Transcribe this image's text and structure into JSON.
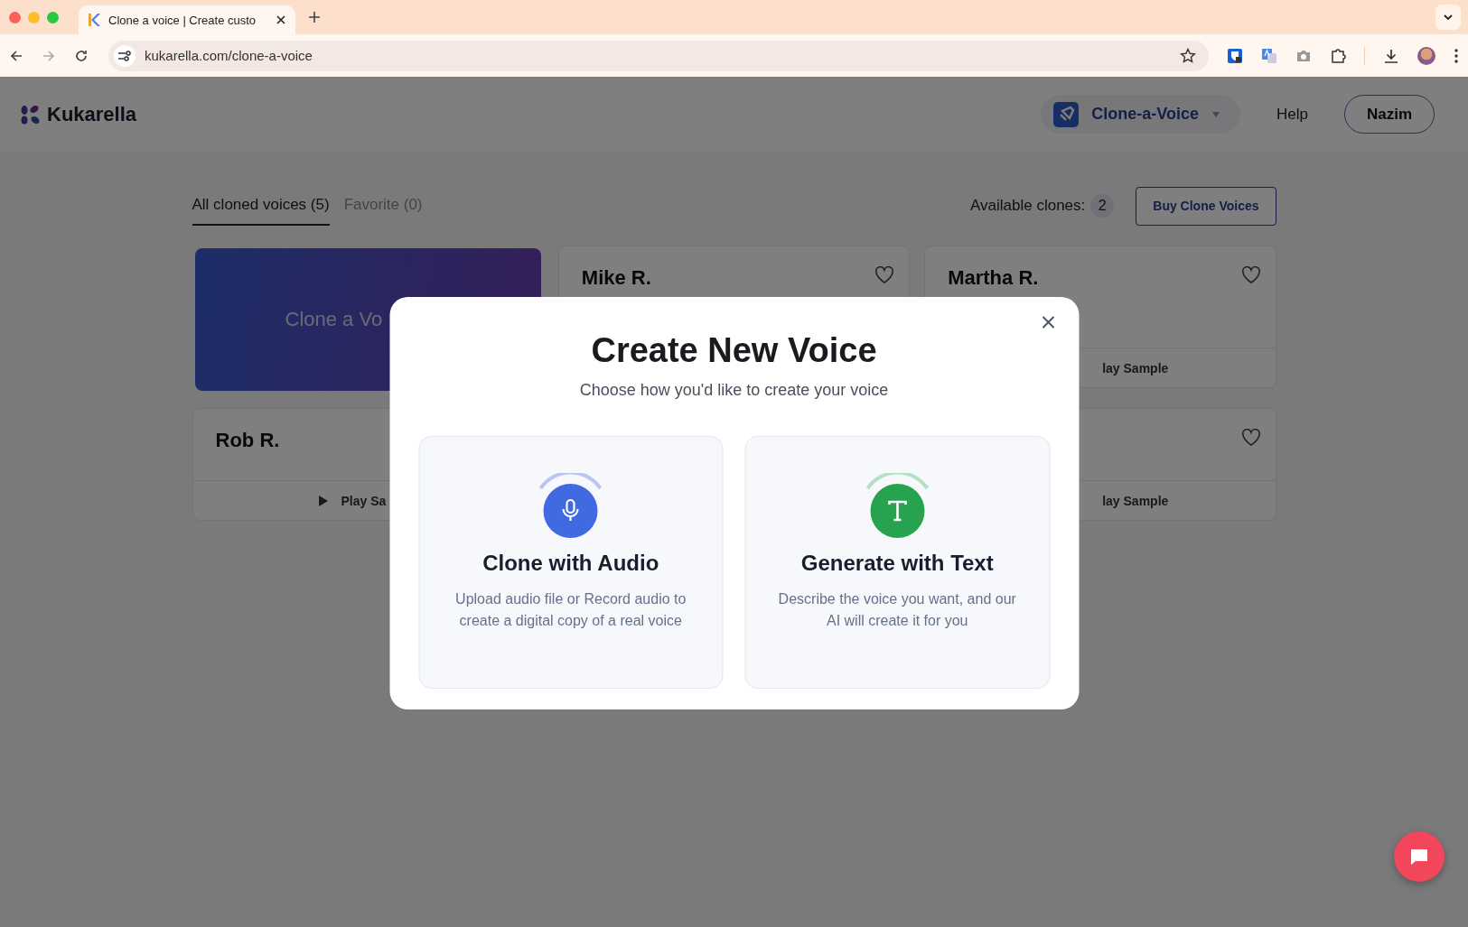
{
  "browser": {
    "tab_title": "Clone a voice | Create custo",
    "url": "kukarella.com/clone-a-voice"
  },
  "header": {
    "logo": "Kukarella",
    "product_switch": "Clone-a-Voice",
    "help": "Help",
    "user": "Nazim"
  },
  "tabs": [
    {
      "label": "All cloned voices (5)",
      "selected": true
    },
    {
      "label": "Favorite (0)",
      "selected": false
    }
  ],
  "available": {
    "label": "Available clones:",
    "count": "2"
  },
  "buy_button": "Buy Clone Voices",
  "cards": [
    {
      "kind": "create",
      "label": "Clone a Vo"
    },
    {
      "kind": "voice",
      "name": "Mike R.",
      "heart": true
    },
    {
      "kind": "voice",
      "name": "Martha R.",
      "heart": true,
      "play_label": "lay Sample"
    },
    {
      "kind": "voice",
      "name": "Rob R.",
      "play_icon": true,
      "play_label": "Play Sa"
    },
    {
      "kind": "voice",
      "heart": true,
      "play_label": "lay Sample"
    }
  ],
  "modal": {
    "title": "Create New Voice",
    "subtitle": "Choose how you'd like to create your voice",
    "options": [
      {
        "kind": "audio",
        "title": "Clone with Audio",
        "description": "Upload audio file or Record audio to create a digital copy of a real voice"
      },
      {
        "kind": "text",
        "title": "Generate with Text",
        "description": "Describe the voice you want, and our AI will create it for you"
      }
    ]
  }
}
